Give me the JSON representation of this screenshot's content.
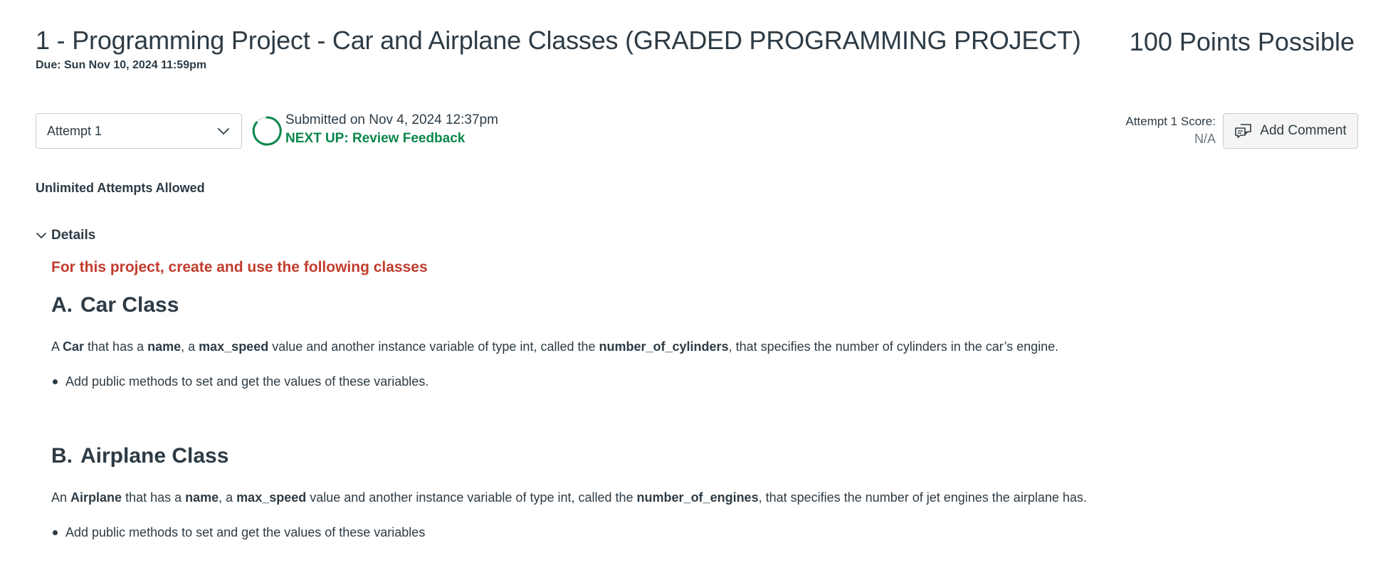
{
  "header": {
    "title": "1 - Programming Project - Car and Airplane Classes (GRADED PROGRAMMING PROJECT)",
    "due": "Due: Sun Nov 10, 2024 11:59pm",
    "points": "100 Points Possible"
  },
  "attempt": {
    "selected": "Attempt 1",
    "submitted": "Submitted on Nov 4, 2024 12:37pm",
    "next_up": "NEXT UP: Review Feedback",
    "score_label": "Attempt 1 Score:",
    "score_value": "N/A",
    "add_comment_label": "Add Comment",
    "allowed": "Unlimited Attempts Allowed"
  },
  "details": {
    "toggle_label": "Details",
    "intro": "For this project, create and use the following classes",
    "sections": [
      {
        "letter": "A.",
        "title": "Car Class",
        "para": {
          "t0": "A ",
          "b0": "Car",
          "t1": " that has a ",
          "b1": "name",
          "t2": ", a ",
          "b2": "max_speed",
          "t3": " value and another instance variable of type int, called the ",
          "b3": "number_of_cylinders",
          "t4": ", that specifies the number of cylinders in the car’s engine."
        },
        "bullet": "Add public methods to set and get the values of these variables."
      },
      {
        "letter": "B.",
        "title": "Airplane Class",
        "para": {
          "t0": "An ",
          "b0": "Airplane",
          "t1": " that has a ",
          "b1": "name",
          "t2": ", a ",
          "b2": "max_speed",
          "t3": " value and another instance variable of type int, called the ",
          "b3": "number_of_engines",
          "t4": ", that specifies the number of jet engines the airplane has."
        },
        "bullet": "Add public methods to set and get the values of these variables"
      }
    ]
  },
  "colors": {
    "text": "#2d3b45",
    "success": "#0b874b",
    "intro_red": "#c23c2d",
    "muted": "#6b7780"
  },
  "icons": {
    "select_arrow": "chevron-down-icon",
    "progress": "progress-ring-icon",
    "comment": "comment-icon",
    "details_toggle": "chevron-down-icon"
  }
}
